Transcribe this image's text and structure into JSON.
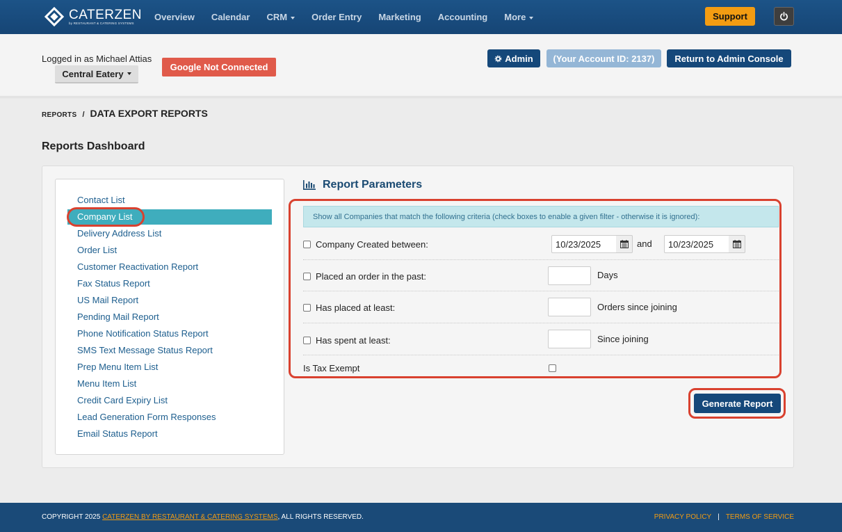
{
  "brand": {
    "name": "CATERZEN",
    "tagline": "by RESTAURANT & CATERING SYSTEMS"
  },
  "nav": {
    "items": [
      {
        "label": "Overview"
      },
      {
        "label": "Calendar"
      },
      {
        "label": "CRM"
      },
      {
        "label": "Order Entry"
      },
      {
        "label": "Marketing"
      },
      {
        "label": "Accounting"
      },
      {
        "label": "More"
      }
    ],
    "support_label": "Support"
  },
  "account": {
    "logged_in_text": "Logged in as Michael Attias",
    "location": "Central Eatery",
    "google_status": "Google Not Connected",
    "admin_label": "Admin",
    "account_id_label": "(Your Account ID: 2137)",
    "return_label": "Return to Admin Console"
  },
  "breadcrumb": {
    "parent": "REPORTS",
    "separator": "/",
    "current": "DATA EXPORT REPORTS"
  },
  "dashboard_title": "Reports Dashboard",
  "reports": [
    "Contact List",
    "Company List",
    "Delivery Address List",
    "Order List",
    "Customer Reactivation Report",
    "Fax Status Report",
    "US Mail Report",
    "Pending Mail Report",
    "Phone Notification Status Report",
    "SMS Text Message Status Report",
    "Prep Menu Item List",
    "Menu Item List",
    "Credit Card Expiry List",
    "Lead Generation Form Responses",
    "Email Status Report"
  ],
  "active_report": "Company List",
  "params": {
    "title": "Report Parameters",
    "info": "Show all Companies that match the following criteria (check boxes to enable a given filter - otherwise it is ignored):",
    "company_created_label": "Company Created between:",
    "date_from": "10/23/2025",
    "and_label": "and",
    "date_to": "10/23/2025",
    "placed_order_label": "Placed an order in the past:",
    "days_label": "Days",
    "placed_at_least_label": "Has placed at least:",
    "orders_since_label": "Orders since joining",
    "spent_at_least_label": "Has spent at least:",
    "since_joining_label": "Since joining",
    "tax_exempt_label": "Is Tax Exempt",
    "generate_label": "Generate Report"
  },
  "footer": {
    "copyright_prefix": "COPYRIGHT 2025 ",
    "copyright_link": "CATERZEN BY RESTAURANT & CATERING SYSTEMS",
    "copyright_suffix": ", ALL RIGHTS RESERVED.",
    "privacy": "PRIVACY POLICY",
    "separator": "|",
    "terms": "TERMS OF SERVICE"
  },
  "colors": {
    "navbar": "#1c5387",
    "accent_orange": "#f39c12",
    "primary_button": "#15487a",
    "active_item": "#3fadbd",
    "annotation_red": "#d9412f",
    "danger": "#e05a4a"
  }
}
